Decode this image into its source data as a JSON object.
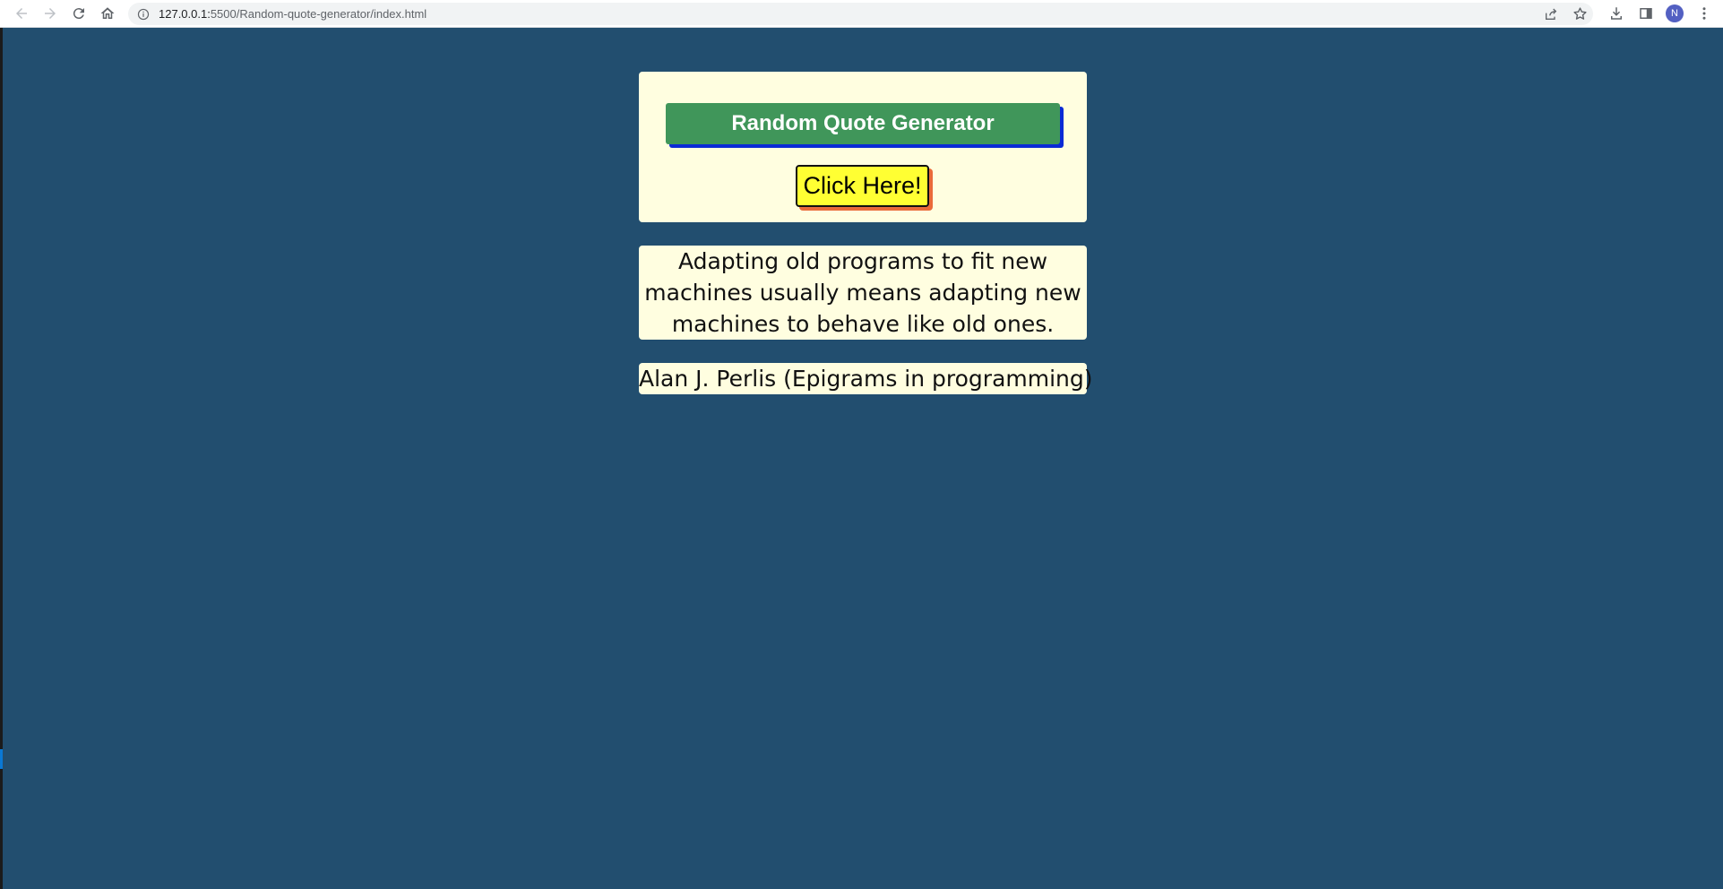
{
  "browser": {
    "url_host": "127.0.0.1:",
    "url_path": "5500/Random-quote-generator/index.html",
    "profile_initial": "N",
    "colors": {
      "page_background": "#224e6f",
      "avatar": "#5360c2"
    }
  },
  "app": {
    "title": "Random Quote Generator",
    "button_label": "Click Here!",
    "colors": {
      "panel_background": "#fffee0",
      "title_background": "#40965a",
      "title_shadow": "#0a2ad6",
      "button_background": "#ffff33",
      "button_shadow": "#ea6a3a"
    }
  },
  "quote": {
    "text": "Adapting old programs to fit new machines usually means adapting new machines to behave like old ones.",
    "author": "Alan J. Perlis (Epigrams in programming)"
  },
  "icons": {
    "back": "arrow-left",
    "forward": "arrow-right",
    "reload": "reload",
    "home": "home",
    "site_info": "info-circle",
    "share": "share",
    "bookmark": "star",
    "downloads": "download",
    "side_panel": "side-panel",
    "menu": "three-dots-vertical"
  }
}
